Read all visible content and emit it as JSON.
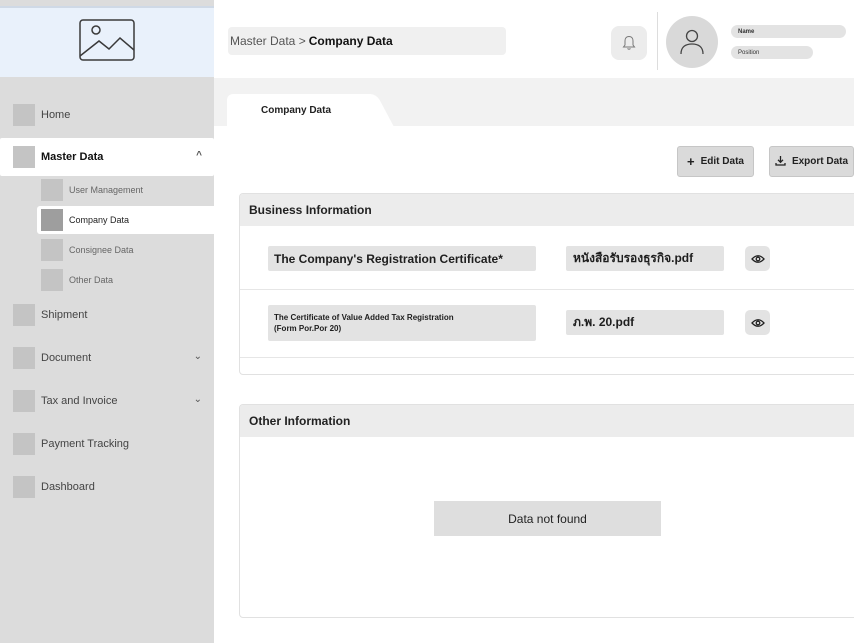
{
  "sidebar": {
    "logo_icon": "image-placeholder-icon",
    "items": [
      {
        "label": "Home"
      },
      {
        "label": "Master Data",
        "chevron": "^"
      },
      {
        "label": "Shipment"
      },
      {
        "label": "Document",
        "chevron": "⌄"
      },
      {
        "label": "Tax and Invoice",
        "chevron": "⌄"
      },
      {
        "label": "Payment Tracking"
      },
      {
        "label": "Dashboard"
      }
    ],
    "sub_items": [
      {
        "label": "User Management"
      },
      {
        "label": "Company Data"
      },
      {
        "label": "Consignee Data"
      },
      {
        "label": "Other Data"
      }
    ]
  },
  "header": {
    "breadcrumb_parent": "Master Data >",
    "breadcrumb_current": "Company Data",
    "user_name": "Name",
    "user_position": "Position"
  },
  "main": {
    "tab_label": "Company Data",
    "edit_button": "Edit Data",
    "export_button": "Export Data",
    "business_section": {
      "title": "Business Information",
      "rows": [
        {
          "label": "The Company's Registration Certificate*",
          "file": "หนังสือรับรองธุรกิจ.pdf"
        },
        {
          "label_line1": "The Certificate of Value Added Tax Registration",
          "label_line2": "(Form Por.Por 20)",
          "file": "ภ.พ. 20.pdf"
        }
      ]
    },
    "other_section": {
      "title": "Other Information",
      "empty_text": "Data not found"
    }
  }
}
